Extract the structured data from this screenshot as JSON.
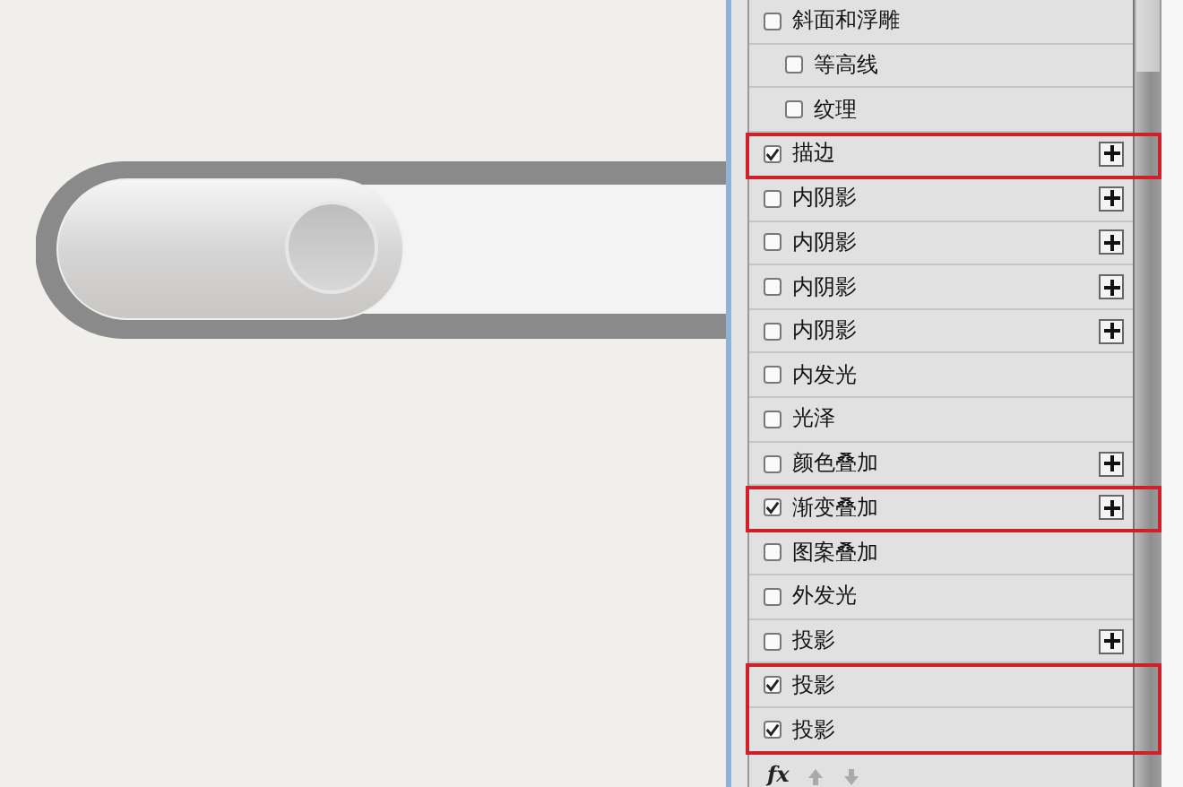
{
  "styles_panel": {
    "items": [
      {
        "label": "斜面和浮雕",
        "checked": false,
        "add_button": false,
        "highlighted": false,
        "children": [
          {
            "label": "等高线",
            "checked": false,
            "add_button": false,
            "highlighted": false
          },
          {
            "label": "纹理",
            "checked": false,
            "add_button": false,
            "highlighted": false
          }
        ]
      },
      {
        "label": "描边",
        "checked": true,
        "add_button": true,
        "highlighted": true
      },
      {
        "label": "内阴影",
        "checked": false,
        "add_button": true,
        "highlighted": false
      },
      {
        "label": "内阴影",
        "checked": false,
        "add_button": true,
        "highlighted": false
      },
      {
        "label": "内阴影",
        "checked": false,
        "add_button": true,
        "highlighted": false
      },
      {
        "label": "内阴影",
        "checked": false,
        "add_button": true,
        "highlighted": false
      },
      {
        "label": "内发光",
        "checked": false,
        "add_button": false,
        "highlighted": false
      },
      {
        "label": "光泽",
        "checked": false,
        "add_button": false,
        "highlighted": false
      },
      {
        "label": "颜色叠加",
        "checked": false,
        "add_button": true,
        "highlighted": false
      },
      {
        "label": "渐变叠加",
        "checked": true,
        "add_button": true,
        "highlighted": true
      },
      {
        "label": "图案叠加",
        "checked": false,
        "add_button": false,
        "highlighted": false
      },
      {
        "label": "外发光",
        "checked": false,
        "add_button": false,
        "highlighted": false
      },
      {
        "label": "投影",
        "checked": false,
        "add_button": true,
        "highlighted": false
      },
      {
        "label": "投影",
        "checked": true,
        "add_button": false,
        "highlighted": true
      },
      {
        "label": "投影",
        "checked": true,
        "add_button": false,
        "highlighted": true
      }
    ]
  },
  "footer": {
    "fx_label": "fx"
  }
}
